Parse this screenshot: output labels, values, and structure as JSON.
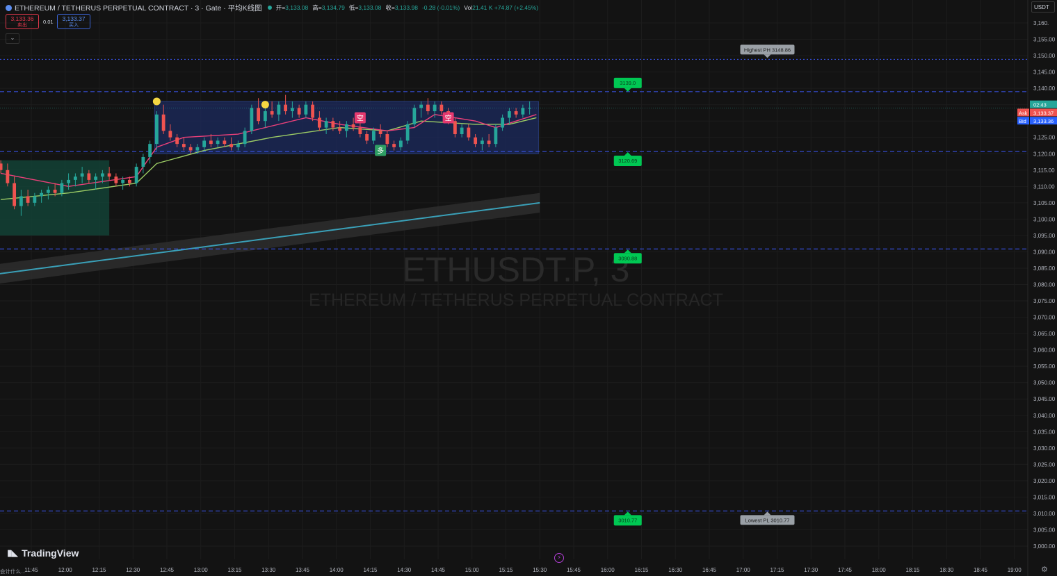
{
  "header": {
    "symbol_title": "ETHEREUM / TETHERUS PERPETUAL CONTRACT · 3 · Gate · 平均K线图",
    "open_label": "开=",
    "open_value": "3,133.08",
    "high_label": "高=",
    "high_value": "3,134.79",
    "low_label": "低=",
    "low_value": "3,133.08",
    "close_label": "收=",
    "close_value": "3,133.98",
    "change": "-0.28 (-0.01%)",
    "vol_label": "Vol",
    "vol_value": "21.41 K",
    "vol_change": "+74.87 (+2.45%)"
  },
  "trade_panel": {
    "sell_price": "3,133.36",
    "sell_label": "卖出",
    "spread": "0.01",
    "buy_price": "3,133.37",
    "buy_label": "买入",
    "collapse_icon": "chevron-down-icon"
  },
  "currency": "USDT",
  "watermark": {
    "symbol": "ETHUSDT.P, 3",
    "name": "ETHEREUM / TETHERUS PERPETUAL CONTRACT"
  },
  "brand": "TradingView",
  "corner_text": "会计什么...",
  "colors": {
    "up": "#26a69a",
    "down": "#ef5350",
    "level_line": "#3d5afe",
    "tag_green": "#00c853",
    "range_box": "#1c2a5e",
    "ema_green": "#9ccc65",
    "ema_pink": "#ec407a",
    "trend": "#3aa0b8",
    "demand_zone": "#134236"
  },
  "chart_data": {
    "type": "candlestick",
    "x_axis_labels": [
      "11:45",
      "12:00",
      "12:15",
      "12:30",
      "12:45",
      "13:00",
      "13:15",
      "13:30",
      "13:45",
      "14:00",
      "14:15",
      "14:30",
      "14:45",
      "15:00",
      "15:15",
      "15:30",
      "15:45",
      "16:00",
      "16:15",
      "16:30",
      "16:45",
      "17:00",
      "17:15",
      "17:30",
      "17:45",
      "18:00",
      "18:15",
      "18:30",
      "18:45",
      "19:00"
    ],
    "y_axis_labels": [
      "3,160.",
      "3,155.00",
      "3,150.00",
      "3,145.00",
      "3,140.00",
      "3,135.00",
      "3,130.00",
      "3,125.00",
      "3,120.00",
      "3,115.00",
      "3,110.00",
      "3,105.00",
      "3,100.00",
      "3,095.00",
      "3,090.00",
      "3,085.00",
      "3,080.00",
      "3,075.00",
      "3,070.00",
      "3,065.00",
      "3,060.00",
      "3,055.00",
      "3,050.00",
      "3,045.00",
      "3,040.00",
      "3,035.00",
      "3,030.00",
      "3,025.00",
      "3,020.00",
      "3,015.00",
      "3,010.00",
      "3,005.00",
      "3,000.00"
    ],
    "y_range": [
      2998,
      3161
    ],
    "start_time": "11:30",
    "bar_minutes": 3,
    "candles": [
      [
        3117,
        3118,
        3114,
        3115
      ],
      [
        3115,
        3117,
        3110,
        3111
      ],
      [
        3111,
        3113,
        3103,
        3104
      ],
      [
        3104,
        3109,
        3101,
        3107
      ],
      [
        3107,
        3109,
        3104,
        3105
      ],
      [
        3105,
        3108,
        3104,
        3107
      ],
      [
        3107,
        3109,
        3105,
        3108
      ],
      [
        3108,
        3110,
        3106,
        3109
      ],
      [
        3109,
        3111,
        3107,
        3108
      ],
      [
        3108,
        3112,
        3107,
        3111
      ],
      [
        3111,
        3114,
        3109,
        3112
      ],
      [
        3112,
        3114,
        3110,
        3113
      ],
      [
        3113,
        3116,
        3111,
        3114
      ],
      [
        3114,
        3115,
        3111,
        3112
      ],
      [
        3112,
        3114,
        3109,
        3113
      ],
      [
        3113,
        3115,
        3111,
        3114
      ],
      [
        3114,
        3116,
        3112,
        3113
      ],
      [
        3113,
        3114,
        3110,
        3111
      ],
      [
        3111,
        3113,
        3109,
        3112
      ],
      [
        3112,
        3113,
        3110,
        3111
      ],
      [
        3111,
        3117,
        3110,
        3116
      ],
      [
        3116,
        3120,
        3114,
        3119
      ],
      [
        3119,
        3124,
        3117,
        3123
      ],
      [
        3123,
        3133,
        3121,
        3132
      ],
      [
        3132,
        3135,
        3126,
        3127
      ],
      [
        3127,
        3129,
        3124,
        3125
      ],
      [
        3125,
        3126,
        3122,
        3123
      ],
      [
        3123,
        3125,
        3121,
        3122
      ],
      [
        3122,
        3123,
        3120,
        3121
      ],
      [
        3121,
        3123,
        3120,
        3122
      ],
      [
        3122,
        3125,
        3121,
        3124
      ],
      [
        3124,
        3126,
        3122,
        3123
      ],
      [
        3123,
        3125,
        3122,
        3124
      ],
      [
        3124,
        3125,
        3122,
        3123
      ],
      [
        3123,
        3125,
        3121,
        3122
      ],
      [
        3122,
        3124,
        3121,
        3123
      ],
      [
        3123,
        3128,
        3122,
        3127
      ],
      [
        3127,
        3135,
        3126,
        3134
      ],
      [
        3134,
        3137,
        3129,
        3130
      ],
      [
        3130,
        3134,
        3128,
        3133
      ],
      [
        3133,
        3136,
        3131,
        3132
      ],
      [
        3132,
        3136,
        3130,
        3135
      ],
      [
        3135,
        3138,
        3132,
        3133
      ],
      [
        3133,
        3136,
        3131,
        3134
      ],
      [
        3134,
        3135,
        3131,
        3132
      ],
      [
        3132,
        3136,
        3131,
        3135
      ],
      [
        3135,
        3136,
        3130,
        3131
      ],
      [
        3131,
        3133,
        3127,
        3128
      ],
      [
        3128,
        3131,
        3126,
        3130
      ],
      [
        3130,
        3131,
        3127,
        3128
      ],
      [
        3128,
        3130,
        3126,
        3127
      ],
      [
        3127,
        3130,
        3125,
        3129
      ],
      [
        3129,
        3131,
        3127,
        3128
      ],
      [
        3128,
        3130,
        3125,
        3126
      ],
      [
        3126,
        3127,
        3123,
        3124
      ],
      [
        3124,
        3128,
        3123,
        3127
      ],
      [
        3127,
        3129,
        3125,
        3126
      ],
      [
        3126,
        3127,
        3122,
        3123
      ],
      [
        3123,
        3124,
        3121,
        3122
      ],
      [
        3122,
        3125,
        3121,
        3124
      ],
      [
        3124,
        3130,
        3123,
        3129
      ],
      [
        3129,
        3135,
        3128,
        3134
      ],
      [
        3134,
        3136,
        3131,
        3135
      ],
      [
        3135,
        3137,
        3132,
        3133
      ],
      [
        3133,
        3136,
        3131,
        3135
      ],
      [
        3135,
        3136,
        3132,
        3133
      ],
      [
        3133,
        3134,
        3129,
        3130
      ],
      [
        3130,
        3131,
        3125,
        3126
      ],
      [
        3126,
        3129,
        3125,
        3128
      ],
      [
        3128,
        3129,
        3124,
        3125
      ],
      [
        3125,
        3126,
        3122,
        3123
      ],
      [
        3123,
        3125,
        3121,
        3124
      ],
      [
        3124,
        3126,
        3122,
        3123
      ],
      [
        3123,
        3129,
        3122,
        3128
      ],
      [
        3128,
        3132,
        3127,
        3131
      ],
      [
        3131,
        3134,
        3129,
        3133
      ],
      [
        3133,
        3134,
        3131,
        3132
      ],
      [
        3132,
        3135,
        3131,
        3134
      ],
      [
        3134,
        3136,
        3132,
        3134
      ]
    ],
    "ema_fast": [
      [
        0,
        3114
      ],
      [
        10,
        3110
      ],
      [
        20,
        3113
      ],
      [
        23,
        3122
      ],
      [
        27,
        3125
      ],
      [
        35,
        3126
      ],
      [
        45,
        3131
      ],
      [
        50,
        3129
      ],
      [
        57,
        3127
      ],
      [
        61,
        3128
      ],
      [
        64,
        3132
      ],
      [
        70,
        3130
      ],
      [
        73,
        3128
      ],
      [
        79,
        3132
      ]
    ],
    "ema_slow": [
      [
        0,
        3106
      ],
      [
        10,
        3108
      ],
      [
        20,
        3111
      ],
      [
        23,
        3117
      ],
      [
        30,
        3121
      ],
      [
        40,
        3125
      ],
      [
        50,
        3128
      ],
      [
        57,
        3127
      ],
      [
        62,
        3130
      ],
      [
        70,
        3129
      ],
      [
        75,
        3129
      ],
      [
        79,
        3131
      ]
    ],
    "trend_band": {
      "start": [
        -1.3,
        3083
      ],
      "end": [
        79.5,
        3105
      ],
      "half_width_price": 3
    },
    "range_box": {
      "from_bar": 23,
      "to_bar": 79,
      "top": 3136,
      "bottom": 3120
    },
    "demand_zone": {
      "from_bar": -1.3,
      "to_bar": 16,
      "top": 3118,
      "bottom": 3095
    },
    "horizontal_levels": [
      {
        "price": 3148.86,
        "style": "dotted"
      },
      {
        "price": 3139.0,
        "style": "dashed"
      },
      {
        "price": 3120.69,
        "style": "dashed"
      },
      {
        "price": 3090.88,
        "style": "dashed"
      },
      {
        "price": 3010.77,
        "style": "dashed"
      }
    ],
    "level_tags": [
      {
        "price": 3139.0,
        "text": "3139.0",
        "at_time": "16:00"
      },
      {
        "price": 3120.69,
        "text": "3120.69",
        "at_time": "16:00"
      },
      {
        "price": 3090.88,
        "text": "3090.88",
        "at_time": "16:00"
      },
      {
        "price": 3010.77,
        "text": "3010.77",
        "at_time": "16:00"
      }
    ],
    "annotations": [
      {
        "text": "Highest PH 3148.86",
        "price": 3148.86,
        "at_time": "17:15"
      },
      {
        "text": "Lowest PL 3010.77",
        "price": 3010.77,
        "at_time": "17:15"
      }
    ],
    "signals": [
      {
        "text": "空",
        "bar": 53,
        "price": 3131,
        "side": "short"
      },
      {
        "text": "空",
        "bar": 66,
        "price": 3131,
        "side": "short"
      },
      {
        "text": "多",
        "bar": 56,
        "price": 3121,
        "side": "long"
      }
    ],
    "circle_markers": [
      {
        "bar": 23,
        "price": 3136
      },
      {
        "bar": 39,
        "price": 3135
      }
    ],
    "price_labels": [
      {
        "text": "02:43",
        "sub": "3,133.",
        "price": 3135,
        "kind": "countdown"
      },
      {
        "label": "Ask",
        "text": "3,133.37",
        "price": 3132.5,
        "kind": "ask"
      },
      {
        "label": "Bid",
        "text": "3,133.36",
        "price": 3130,
        "kind": "bid"
      }
    ]
  }
}
